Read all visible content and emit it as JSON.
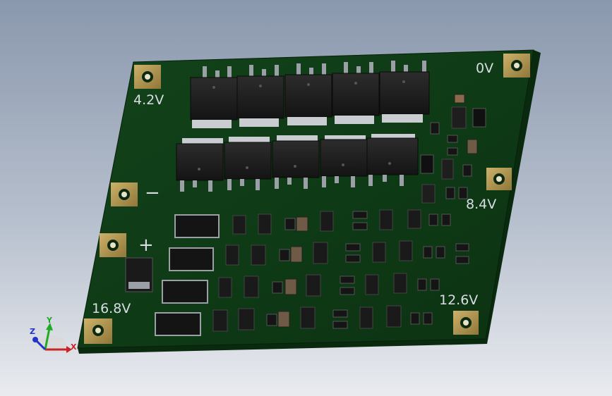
{
  "colors": {
    "background_top": "#8a98ad",
    "background_bottom": "#e9ebef",
    "pcb_green": "#103c16",
    "pad_gold": "#b59a52",
    "component_black": "#1c1c1c",
    "silkscreen": "#d8dde4"
  },
  "board": {
    "labels": {
      "v42": "4.2V",
      "v0": "0V",
      "v84": "8.4V",
      "v126": "12.6V",
      "v168": "16.8V",
      "minus": "−",
      "plus": "+"
    }
  },
  "triad": {
    "x": "X",
    "y": "Y",
    "z": "Z"
  }
}
